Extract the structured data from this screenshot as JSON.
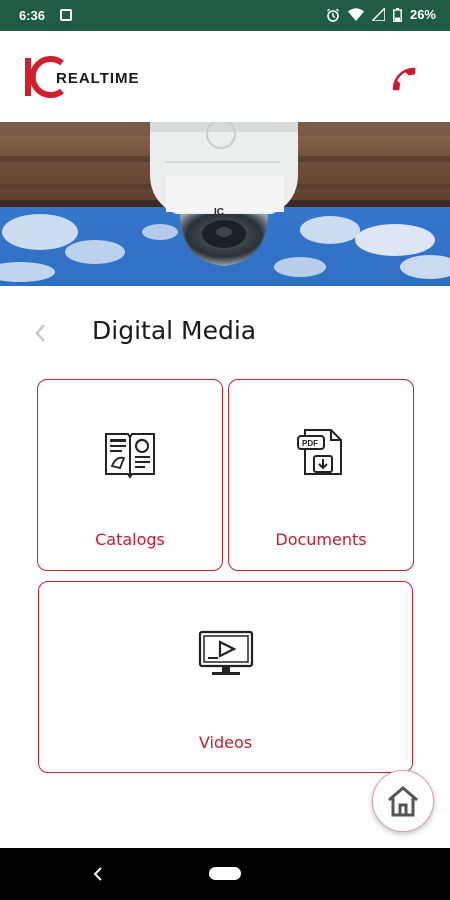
{
  "status_bar": {
    "time": "6:36",
    "battery": "26%",
    "icons": [
      "image-icon",
      "alarm-icon",
      "wifi-icon",
      "signal-icon",
      "battery-icon"
    ]
  },
  "header": {
    "logo_mark": "IC",
    "logo_text": "REALTIME",
    "phone_icon": "phone-icon",
    "brand_color": "#c91b2b"
  },
  "banner": {
    "camera_logo": "IC"
  },
  "page": {
    "title": "Digital Media",
    "back_icon": "chevron-left-icon"
  },
  "cards": [
    {
      "label": "Catalogs",
      "icon": "catalog-book-icon"
    },
    {
      "label": "Documents",
      "icon": "pdf-download-icon"
    },
    {
      "label": "Videos",
      "icon": "video-monitor-icon"
    }
  ],
  "fab": {
    "icon": "home-icon"
  },
  "nav_bar": {
    "back_icon": "nav-back-icon",
    "home_pill": "nav-home-pill"
  }
}
